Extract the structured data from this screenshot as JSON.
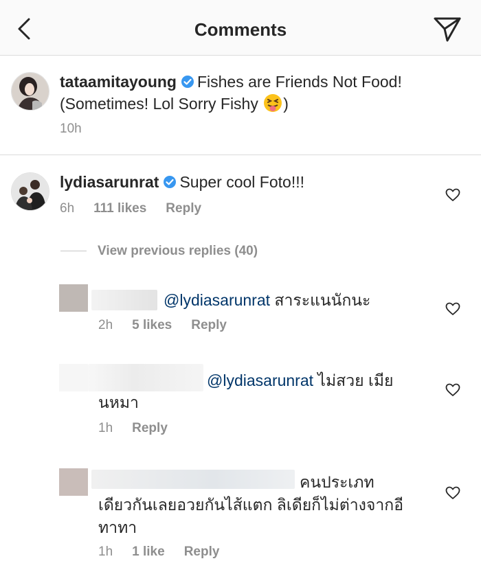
{
  "header": {
    "title": "Comments",
    "back_icon": "back-chevron-icon",
    "send_icon": "send-icon"
  },
  "caption": {
    "username": "tataamitayoung",
    "text_line1": "Fishes are Friends Not Food!",
    "text_line2": "(Sometimes! Lol Sorry Fishy",
    "emoji": "😝",
    "text_end": ")",
    "time": "10h"
  },
  "comment": {
    "username": "lydiasarunrat",
    "text": "Super cool Foto!!!",
    "time": "6h",
    "likes": "111 likes",
    "reply": "Reply"
  },
  "view_previous": "View previous replies (40)",
  "replies": [
    {
      "mention": "@lydiasarunrat",
      "text": "สาระแนนักนะ",
      "time": "2h",
      "likes": "5 likes",
      "reply": "Reply"
    },
    {
      "mention": "@lydiasarunrat",
      "text": "ไม่สวย เมีย",
      "text2": "นหมา",
      "time": "1h",
      "reply": "Reply"
    },
    {
      "text": "คนประเภท",
      "text2": "เดียวกันเลยอวยกันไส้แตก ลิเดียก็ไม่ต่างจากอี",
      "text3": "ทาทา",
      "time": "1h",
      "likes": "1 like",
      "reply": "Reply"
    }
  ],
  "colors": {
    "verified": "#3897f0",
    "mention": "#003569",
    "meta": "#8e8e8e"
  }
}
